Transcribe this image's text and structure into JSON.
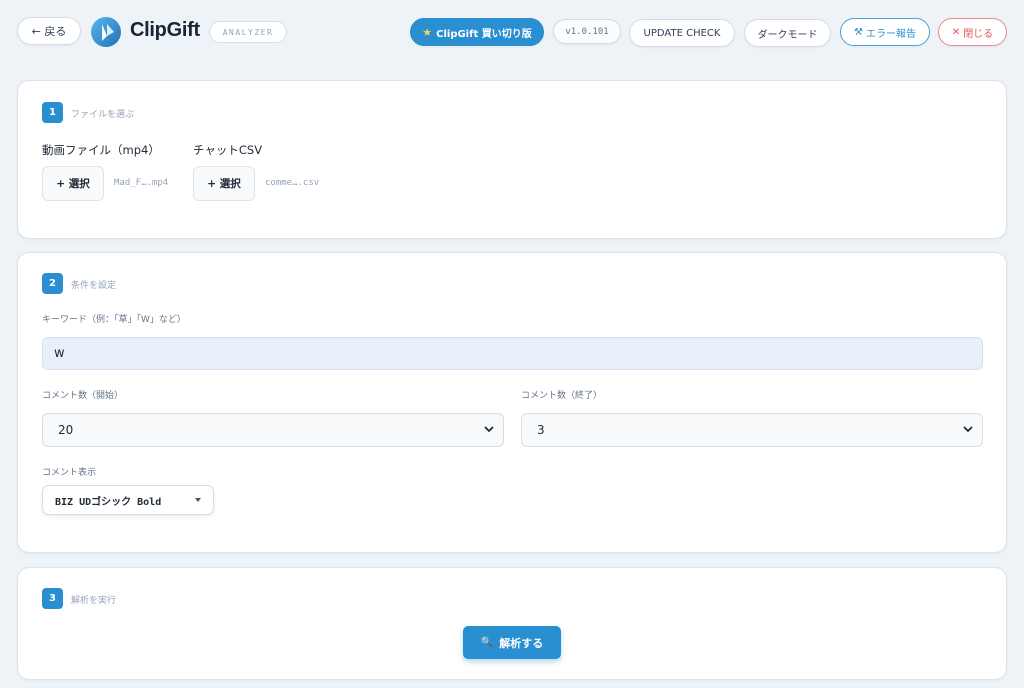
{
  "header": {
    "back_label": "← 戻る",
    "app_name": "ClipGift",
    "badge": "ANALYZER",
    "premium_label": "ClipGift 買い切り版",
    "version": "v1.0.101",
    "update_label": "UPDATE CHECK",
    "dark_label": "ダークモード",
    "error_label": "エラー報告",
    "close_label": "閉じる",
    "colors": {
      "accent": "#2a8fd0",
      "danger": "#e25757"
    }
  },
  "step1": {
    "number": "1",
    "title": "ファイルを選ぶ",
    "video": {
      "label": "動画ファイル（mp4）",
      "button": "+ 選択",
      "file": "Mad_F….mp4"
    },
    "chat": {
      "label": "チャットCSV",
      "button": "+ 選択",
      "file": "comme….csv"
    }
  },
  "step2": {
    "number": "2",
    "title": "条件を設定",
    "keyword_label": "キーワード（例：「草」「W」など）",
    "keyword_value": "w",
    "start_label": "コメント数（開始）",
    "start_value": "20",
    "end_label": "コメント数（終了）",
    "end_value": "3",
    "display_label": "コメント表示",
    "font_value": "BIZ UDゴシック Bold"
  },
  "step3": {
    "number": "3",
    "title": "解析を実行",
    "run_label": "解析する"
  }
}
